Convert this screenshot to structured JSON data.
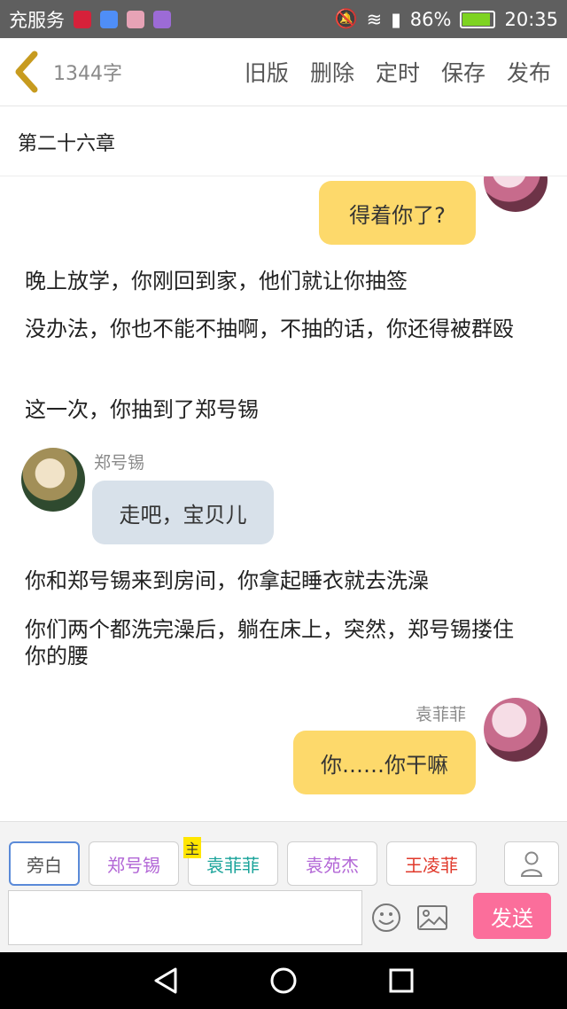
{
  "status_bar": {
    "carrier_text": "充服务",
    "battery_percent": "86%",
    "battery_level": 0.86,
    "time": "20:35"
  },
  "toolbar": {
    "word_count": "1344字",
    "actions": [
      "旧版",
      "删除",
      "定时",
      "保存",
      "发布"
    ]
  },
  "chapter": {
    "title": "第二十六章"
  },
  "messages": {
    "m1_text": "得着你了?",
    "n1": "晚上放学，你刚回到家，他们就让你抽签",
    "n2": "没办法，你也不能不抽啊，不抽的话，你还得被群殴",
    "n3": "这一次，你抽到了郑号锡",
    "m2_sender": "郑号锡",
    "m2_text": "走吧，宝贝儿",
    "n4": "你和郑号锡来到房间，你拿起睡衣就去洗澡",
    "n5": "你们两个都洗完澡后，躺在床上，突然，郑号锡搂住你的腰",
    "m3_sender": "袁菲菲",
    "m3_text": "你……你干嘛"
  },
  "role_tabs": {
    "items": [
      {
        "label": "旁白",
        "color": "#555555"
      },
      {
        "label": "郑号锡",
        "color": "#b266d6"
      },
      {
        "label": "袁菲菲",
        "color": "#1aa39a"
      },
      {
        "label": "袁苑杰",
        "color": "#b266d6"
      },
      {
        "label": "王凌菲",
        "color": "#e0392b"
      }
    ],
    "host_mark": "主"
  },
  "composer": {
    "input_value": "",
    "send_label": "发送"
  },
  "colors": {
    "accent_yellow": "#fdd96b",
    "send_pink": "#fb6e9b",
    "back_arrow": "#c79b1f"
  }
}
